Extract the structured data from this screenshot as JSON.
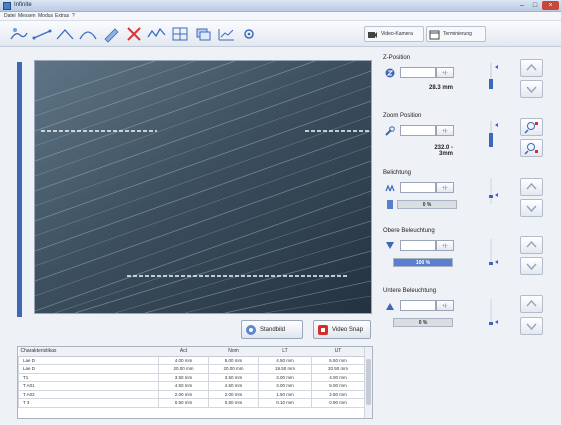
{
  "window": {
    "title": "Infinite"
  },
  "menu": [
    "Datei",
    "Messen",
    "Modus",
    "Extras",
    "?"
  ],
  "toolbar": {
    "tools": [
      "zoom-tool-icon",
      "measure-distance-icon",
      "measure-angle-icon",
      "measure-arc-icon",
      "edit-tool-icon",
      "delete-tool-icon",
      "profile-tool-icon",
      "grid-tool-icon",
      "focus-stack-icon",
      "chart-tool-icon",
      "settings-tool-icon"
    ],
    "tabs": [
      {
        "label": "Video-Kamera",
        "icon": "camera-icon"
      },
      {
        "label": "Terminierung",
        "icon": "calendar-icon"
      }
    ]
  },
  "image_buttons": {
    "standbild": "Standbild",
    "snap": "Video Snap"
  },
  "table": {
    "headers": [
      "Charakteristikas",
      "Act",
      "Nom",
      "LT",
      "UT"
    ],
    "rows": [
      [
        "Lae D",
        "4.00 mm",
        "5.00 mm",
        "4.50 mm",
        "5.50 mm"
      ],
      [
        "Lae D",
        "20.00 mm",
        "20.00 mm",
        "19.50 mm",
        "20.50 mm"
      ],
      [
        "T1",
        "3.50 mm",
        "3.50 mm",
        "3.00 mm",
        "4.00 mm"
      ],
      [
        "T A01",
        "4.50 mm",
        "4.50 mm",
        "3.00 mm",
        "5.00 mm"
      ],
      [
        "T A02",
        "2.00 mm",
        "2.00 mm",
        "1.50 mm",
        "2.50 mm"
      ],
      [
        "T 3",
        "0.50 mm",
        "0.50 mm",
        "0.10 mm",
        "0.90 mm"
      ]
    ]
  },
  "panel": {
    "z": {
      "title": "Z-Position",
      "spin": "+|-",
      "value": "28.3 mm"
    },
    "zoom": {
      "title": "Zoom Position",
      "spin": "+|-",
      "value": "232.0 - 3mm"
    },
    "sensitivity": {
      "title": "Belichtung",
      "spin": "+|-",
      "bar": "0 %"
    },
    "upper": {
      "title": "Obere Beleuchtung",
      "spin": "+|-",
      "bar": "100 %"
    },
    "lower": {
      "title": "Untere Beleuchtung",
      "spin": "+|-",
      "bar": "0 %"
    }
  },
  "colors": {
    "accent": "#3e67b6",
    "bar_blue": "#5b7fcf",
    "close": "#c8463a"
  }
}
